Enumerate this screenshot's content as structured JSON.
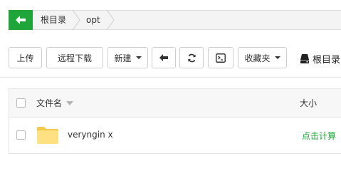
{
  "breadcrumb": {
    "items": [
      {
        "label": "根目录"
      },
      {
        "label": "opt"
      }
    ]
  },
  "toolbar": {
    "upload_label": "上传",
    "remote_download_label": "远程下载",
    "new_label": "新建",
    "favorites_label": "收藏夹",
    "disk_label": "根目录"
  },
  "table": {
    "columns": {
      "name": "文件名",
      "size": "大小"
    },
    "rows": [
      {
        "name": "veryngin x",
        "size_action": "点击计算"
      }
    ]
  },
  "colors": {
    "accent": "#20a53a",
    "folder": "#ffe083",
    "folder_dark": "#f3c94b"
  },
  "icons": [
    "arrow-left-icon",
    "refresh-icon",
    "terminal-icon",
    "disk-icon",
    "folder-icon",
    "sort-icon",
    "chevron-right-icon"
  ]
}
